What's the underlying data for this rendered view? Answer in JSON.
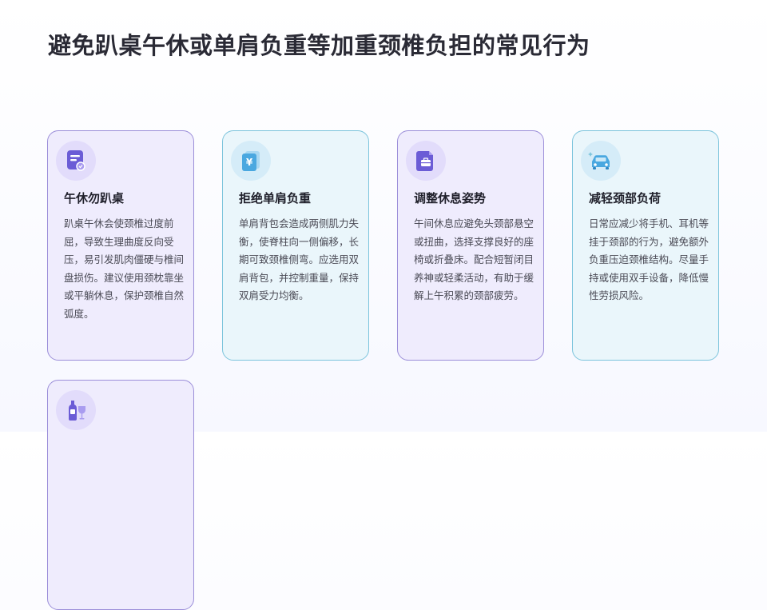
{
  "page": {
    "title": "避免趴桌午休或单肩负重等加重颈椎负担的常见行为"
  },
  "cards": [
    {
      "title": "午休勿趴桌",
      "desc": "趴桌午休会使颈椎过度前屈，导致生理曲度反向受压，易引发肌肉僵硬与椎间盘损伤。建议使用颈枕靠坐或平躺休息，保护颈椎自然弧度。",
      "icon": "document-icon"
    },
    {
      "title": "拒绝单肩负重",
      "desc": "单肩背包会造成两侧肌力失衡，使脊柱向一侧偏移，长期可致颈椎侧弯。应选用双肩背包，并控制重量，保持双肩受力均衡。",
      "icon": "receipt-yen-icon"
    },
    {
      "title": "调整休息姿势",
      "desc": "午间休息应避免头颈部悬空或扭曲，选择支撑良好的座椅或折叠床。配合短暂闭目养神或轻柔活动，有助于缓解上午积累的颈部疲劳。",
      "icon": "briefcase-file-icon"
    },
    {
      "title": "减轻颈部负荷",
      "desc": "日常应减少将手机、耳机等挂于颈部的行为，避免额外负重压迫颈椎结构。尽量手持或使用双手设备，降低慢性劳损风险。",
      "icon": "car-icon"
    },
    {
      "title": "",
      "desc": "",
      "icon": "bottle-glass-icon"
    }
  ],
  "colors": {
    "purple_card_bg": "#efecfd",
    "purple_border": "#9b8ed9",
    "blue_card_bg": "#eaf6fb",
    "blue_border": "#7cc4dc",
    "icon_accent_purple": "#6b5cd6",
    "icon_accent_blue": "#4aa8e0"
  }
}
